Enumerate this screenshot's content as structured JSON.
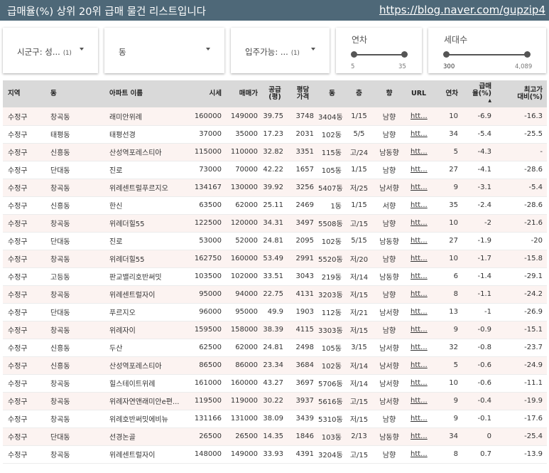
{
  "header": {
    "title": "급매율(%) 상위 20위 급매 물건 리스트입니다",
    "link": "https://blog.naver.com/gupzip4"
  },
  "filters": {
    "district": {
      "label": "시군구: 성...",
      "count": "(1)"
    },
    "dong": {
      "label": "동"
    },
    "move_in": {
      "label": "입주가능: ...",
      "count": "(1)"
    },
    "year_slider": {
      "label": "연차",
      "min": "5",
      "max": "35",
      "min_fraction": 0.0,
      "max_fraction": 1.0
    },
    "households_slider": {
      "label": "세대수",
      "min": "300",
      "max": "4,089",
      "min_fraction": 0.0,
      "max_fraction": 1.0
    }
  },
  "table": {
    "columns": {
      "region": "지역",
      "dong": "동",
      "apt": "아파트 이름",
      "market": "시세",
      "price": "매매가",
      "area_a": "공급",
      "area_b": "(평)",
      "ppa_a": "평당",
      "ppa_b": "가격",
      "bldg": "동",
      "floor": "층",
      "dir": "향",
      "url": "URL",
      "year": "연차",
      "rate_a": "급매",
      "rate_b": "율(%)",
      "peak_a": "최고가",
      "peak_b": "대비(%)"
    },
    "sort_indicator": "▲",
    "rows": [
      [
        "수정구",
        "창곡동",
        "래미안위례",
        "160000",
        "149000",
        "39.75",
        "3748",
        "3404동",
        "1/15",
        "남향",
        "htt...",
        "10",
        "-6.9",
        "-16.3"
      ],
      [
        "수정구",
        "태평동",
        "태평선경",
        "37000",
        "35000",
        "17.23",
        "2031",
        "102동",
        "5/5",
        "남향",
        "htt...",
        "34",
        "-5.4",
        "-25.5"
      ],
      [
        "수정구",
        "신흥동",
        "산성역포레스티아",
        "115000",
        "110000",
        "32.82",
        "3351",
        "115동",
        "고/24",
        "남동향",
        "htt...",
        "5",
        "-4.3",
        "-"
      ],
      [
        "수정구",
        "단대동",
        "진로",
        "73000",
        "70000",
        "42.22",
        "1657",
        "105동",
        "1/15",
        "남향",
        "htt...",
        "27",
        "-4.1",
        "-28.6"
      ],
      [
        "수정구",
        "창곡동",
        "위례센트럴푸르지오",
        "134167",
        "130000",
        "39.92",
        "3256",
        "5407동",
        "저/25",
        "남서향",
        "htt...",
        "9",
        "-3.1",
        "-5.4"
      ],
      [
        "수정구",
        "신흥동",
        "한신",
        "63500",
        "62000",
        "25.11",
        "2469",
        "1동",
        "1/15",
        "서향",
        "htt...",
        "35",
        "-2.4",
        "-28.6"
      ],
      [
        "수정구",
        "창곡동",
        "위례더힐55",
        "122500",
        "120000",
        "34.31",
        "3497",
        "5508동",
        "고/15",
        "남향",
        "htt...",
        "10",
        "-2",
        "-21.6"
      ],
      [
        "수정구",
        "단대동",
        "진로",
        "53000",
        "52000",
        "24.81",
        "2095",
        "102동",
        "5/15",
        "남동향",
        "htt...",
        "27",
        "-1.9",
        "-20"
      ],
      [
        "수정구",
        "창곡동",
        "위례더힐55",
        "162750",
        "160000",
        "53.49",
        "2991",
        "5520동",
        "저/20",
        "남향",
        "htt...",
        "10",
        "-1.7",
        "-15.8"
      ],
      [
        "수정구",
        "고등동",
        "판교밸리호반써밋",
        "103500",
        "102000",
        "33.51",
        "3043",
        "219동",
        "저/14",
        "남동향",
        "htt...",
        "6",
        "-1.4",
        "-29.1"
      ],
      [
        "수정구",
        "창곡동",
        "위례센트럴자이",
        "95000",
        "94000",
        "22.75",
        "4131",
        "3203동",
        "저/15",
        "남향",
        "htt...",
        "8",
        "-1.1",
        "-24.2"
      ],
      [
        "수정구",
        "단대동",
        "푸르지오",
        "96000",
        "95000",
        "49.9",
        "1903",
        "112동",
        "저/21",
        "남서향",
        "htt...",
        "13",
        "-1",
        "-26.9"
      ],
      [
        "수정구",
        "창곡동",
        "위례자이",
        "159500",
        "158000",
        "38.39",
        "4115",
        "3303동",
        "저/15",
        "남향",
        "htt...",
        "9",
        "-0.9",
        "-15.1"
      ],
      [
        "수정구",
        "신흥동",
        "두산",
        "62500",
        "62000",
        "24.81",
        "2498",
        "105동",
        "3/15",
        "남서향",
        "htt...",
        "32",
        "-0.8",
        "-23.7"
      ],
      [
        "수정구",
        "신흥동",
        "산성역포레스티아",
        "86500",
        "86000",
        "23.34",
        "3684",
        "102동",
        "저/14",
        "남서향",
        "htt...",
        "5",
        "-0.6",
        "-24.9"
      ],
      [
        "수정구",
        "창곡동",
        "힐스테이트위례",
        "161000",
        "160000",
        "43.27",
        "3697",
        "5706동",
        "저/14",
        "남서향",
        "htt...",
        "10",
        "-0.6",
        "-11.1"
      ],
      [
        "수정구",
        "창곡동",
        "위례자연앤래미안e편...",
        "119500",
        "119000",
        "30.22",
        "3937",
        "5616동",
        "고/15",
        "남서향",
        "htt...",
        "9",
        "-0.4",
        "-19.9"
      ],
      [
        "수정구",
        "창곡동",
        "위례호반써밋에비뉴",
        "131166",
        "131000",
        "38.09",
        "3439",
        "5310동",
        "저/15",
        "남향",
        "htt...",
        "9",
        "-0.1",
        "-17.6"
      ],
      [
        "수정구",
        "단대동",
        "선경논골",
        "26500",
        "26500",
        "14.35",
        "1846",
        "103동",
        "2/13",
        "남동향",
        "htt...",
        "34",
        "0",
        "-25.4"
      ],
      [
        "수정구",
        "창곡동",
        "위례센트럴자이",
        "148000",
        "149000",
        "33.93",
        "4391",
        "3204동",
        "고/15",
        "남향",
        "htt...",
        "8",
        "0.7",
        "-13.9"
      ]
    ]
  }
}
